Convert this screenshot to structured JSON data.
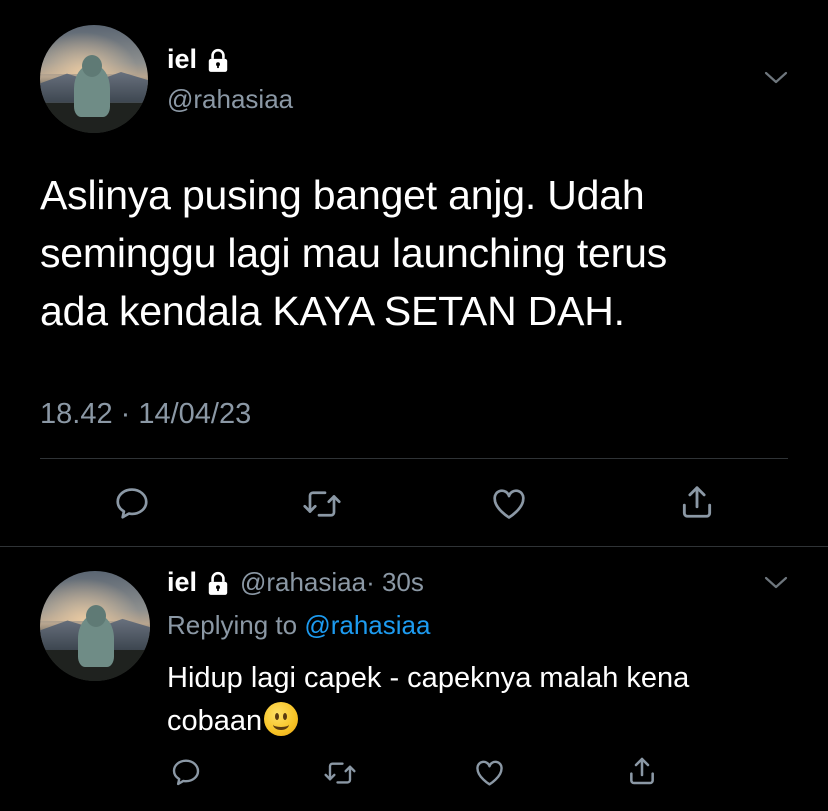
{
  "tweet": {
    "user": {
      "name": "iel",
      "handle": "@rahasiaa",
      "lock_icon": "lock-icon"
    },
    "text_lines": [
      "Aslinya pusing banget anjg. Udah",
      "seminggu lagi mau launching terus",
      "ada kendala KAYA SETAN DAH."
    ],
    "timestamp": "18.42 · 14/04/23",
    "actions": [
      "reply-icon",
      "retweet-icon",
      "like-icon",
      "share-icon"
    ]
  },
  "reply": {
    "user": {
      "name": "iel",
      "handle": "@rahasiaa",
      "time": "· 30s"
    },
    "replying_to_label": "Replying to",
    "replying_to_handle": "@rahasiaa",
    "text_line1": "Hidup lagi capek - capeknya malah kena",
    "text_line2": "cobaan",
    "emoji": "slightly-smiling-face",
    "actions": [
      "reply-icon",
      "retweet-icon",
      "like-icon",
      "share-icon"
    ]
  },
  "colors": {
    "background": "#000000",
    "text": "#ffffff",
    "secondary": "#8b98a5",
    "link": "#1d9bf0",
    "divider": "#2f3336"
  }
}
